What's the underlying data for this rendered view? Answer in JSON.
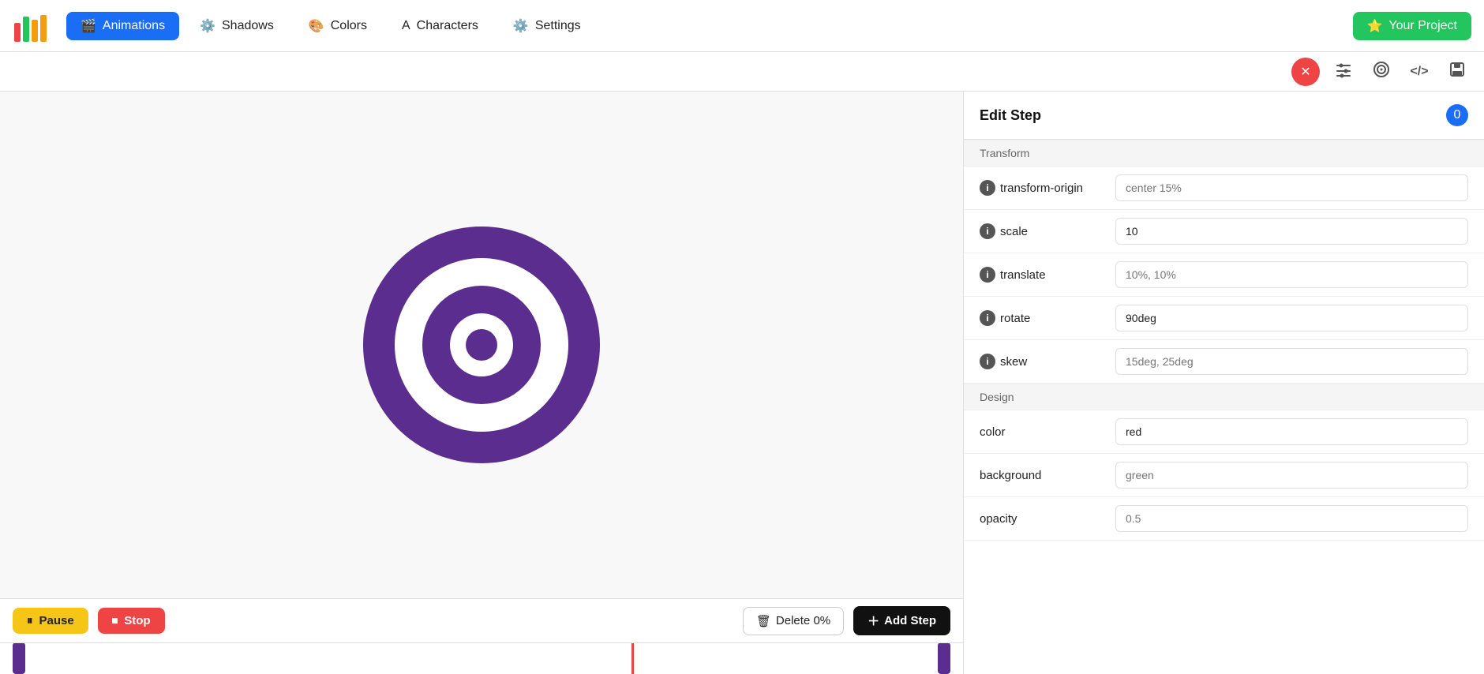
{
  "nav": {
    "animations_label": "Animations",
    "shadows_label": "Shadows",
    "colors_label": "Colors",
    "characters_label": "Characters",
    "settings_label": "Settings",
    "project_label": "Your Project"
  },
  "toolbar": {
    "close_icon": "✕",
    "sliders_icon": "⚙",
    "target_icon": "◎",
    "code_icon": "</>",
    "save_icon": "💾"
  },
  "panel": {
    "title": "Edit Step",
    "close_label": "0",
    "transform_section": "Transform",
    "design_section": "Design",
    "fields": {
      "transform_origin_label": "transform-origin",
      "transform_origin_placeholder": "center 15%",
      "scale_label": "scale",
      "scale_value": "10",
      "translate_label": "translate",
      "translate_placeholder": "10%, 10%",
      "rotate_label": "rotate",
      "rotate_value": "90deg",
      "skew_label": "skew",
      "skew_placeholder": "15deg, 25deg",
      "color_label": "color",
      "color_value": "red",
      "background_label": "background",
      "background_placeholder": "green",
      "opacity_label": "opacity",
      "opacity_placeholder": "0.5"
    }
  },
  "controls": {
    "pause_label": "Pause",
    "stop_label": "Stop",
    "delete_label": "Delete 0%",
    "add_step_label": "Add Step"
  },
  "logo": {
    "colors": [
      "#ef4444",
      "#22c55e",
      "#f59e0b",
      "#f59e0b"
    ]
  }
}
